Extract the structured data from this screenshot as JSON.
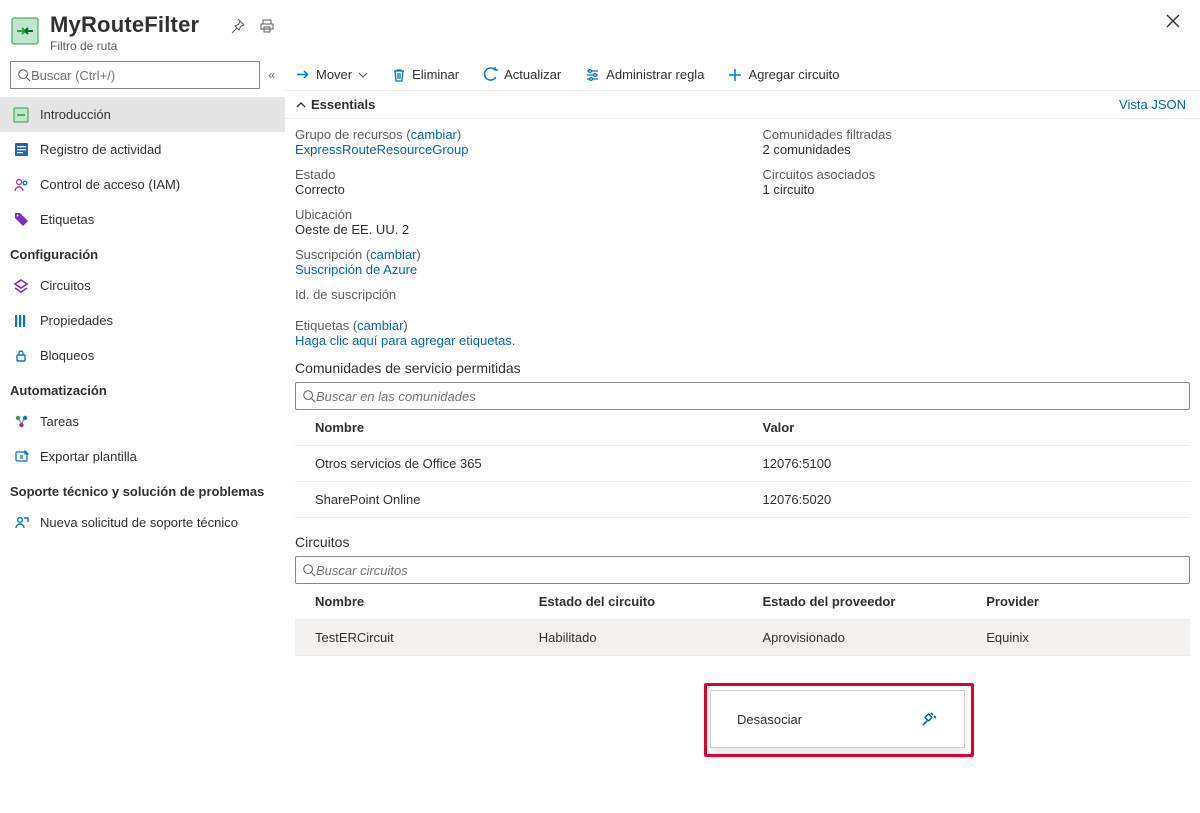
{
  "header": {
    "title": "MyRouteFilter",
    "subtitle": "Filtro de ruta"
  },
  "sidebar": {
    "search_placeholder": "Buscar (Ctrl+/)",
    "groups": [
      {
        "title": null,
        "items": [
          {
            "label": "Introducción",
            "icon": "overview",
            "active": true
          },
          {
            "label": "Registro de actividad",
            "icon": "activity"
          },
          {
            "label": "Control de acceso (IAM)",
            "icon": "iam"
          },
          {
            "label": "Etiquetas",
            "icon": "tag"
          }
        ]
      },
      {
        "title": "Configuración",
        "items": [
          {
            "label": "Circuitos",
            "icon": "circuits"
          },
          {
            "label": "Propiedades",
            "icon": "properties"
          },
          {
            "label": "Bloqueos",
            "icon": "locks"
          }
        ]
      },
      {
        "title": "Automatización",
        "items": [
          {
            "label": "Tareas",
            "icon": "tasks"
          },
          {
            "label": "Exportar plantilla",
            "icon": "export"
          }
        ]
      },
      {
        "title": "Soporte técnico y solución de problemas",
        "items": [
          {
            "label": "Nueva solicitud de soporte técnico",
            "icon": "support"
          }
        ]
      }
    ]
  },
  "toolbar": {
    "move": "Mover",
    "delete": "Eliminar",
    "refresh": "Actualizar",
    "manage_rule": "Administrar regla",
    "add_circuit": "Agregar circuito"
  },
  "essentials": {
    "toggle_label": "Essentials",
    "json_view": "Vista JSON",
    "left": [
      {
        "label": "Grupo de recursos",
        "change": "cambiar",
        "value": "ExpressRouteResourceGroup",
        "value_is_link": true
      },
      {
        "label": "Estado",
        "value": "Correcto"
      },
      {
        "label": "Ubicación",
        "value": "Oeste de EE. UU. 2"
      },
      {
        "label": "Suscripción",
        "change": "cambiar",
        "value": "Suscripción de Azure",
        "value_is_link": true
      },
      {
        "label": "Id. de suscripción",
        "value": ""
      }
    ],
    "right": [
      {
        "label": "Comunidades filtradas",
        "value": "2 comunidades"
      },
      {
        "label": "Circuitos asociados",
        "value": "1 circuito"
      }
    ],
    "tags": {
      "label": "Etiquetas",
      "change": "cambiar",
      "value": "Haga clic aquí para agregar etiquetas."
    }
  },
  "communities": {
    "title": "Comunidades de servicio permitidas",
    "search_placeholder": "Buscar en las comunidades",
    "columns": [
      "Nombre",
      "Valor"
    ],
    "rows": [
      {
        "name": "Otros servicios de Office 365",
        "value": "12076:5100"
      },
      {
        "name": "SharePoint Online",
        "value": "12076:5020"
      }
    ]
  },
  "circuits": {
    "title": "Circuitos",
    "search_placeholder": "Buscar circuitos",
    "columns": [
      "Nombre",
      "Estado del circuito",
      "Estado del proveedor",
      "Provider"
    ],
    "rows": [
      {
        "name": "TestERCircuit",
        "circuit_state": "Habilitado",
        "provider_state": "Aprovisionado",
        "provider": "Equinix"
      }
    ]
  },
  "context_menu": {
    "dissociate": "Desasociar"
  }
}
